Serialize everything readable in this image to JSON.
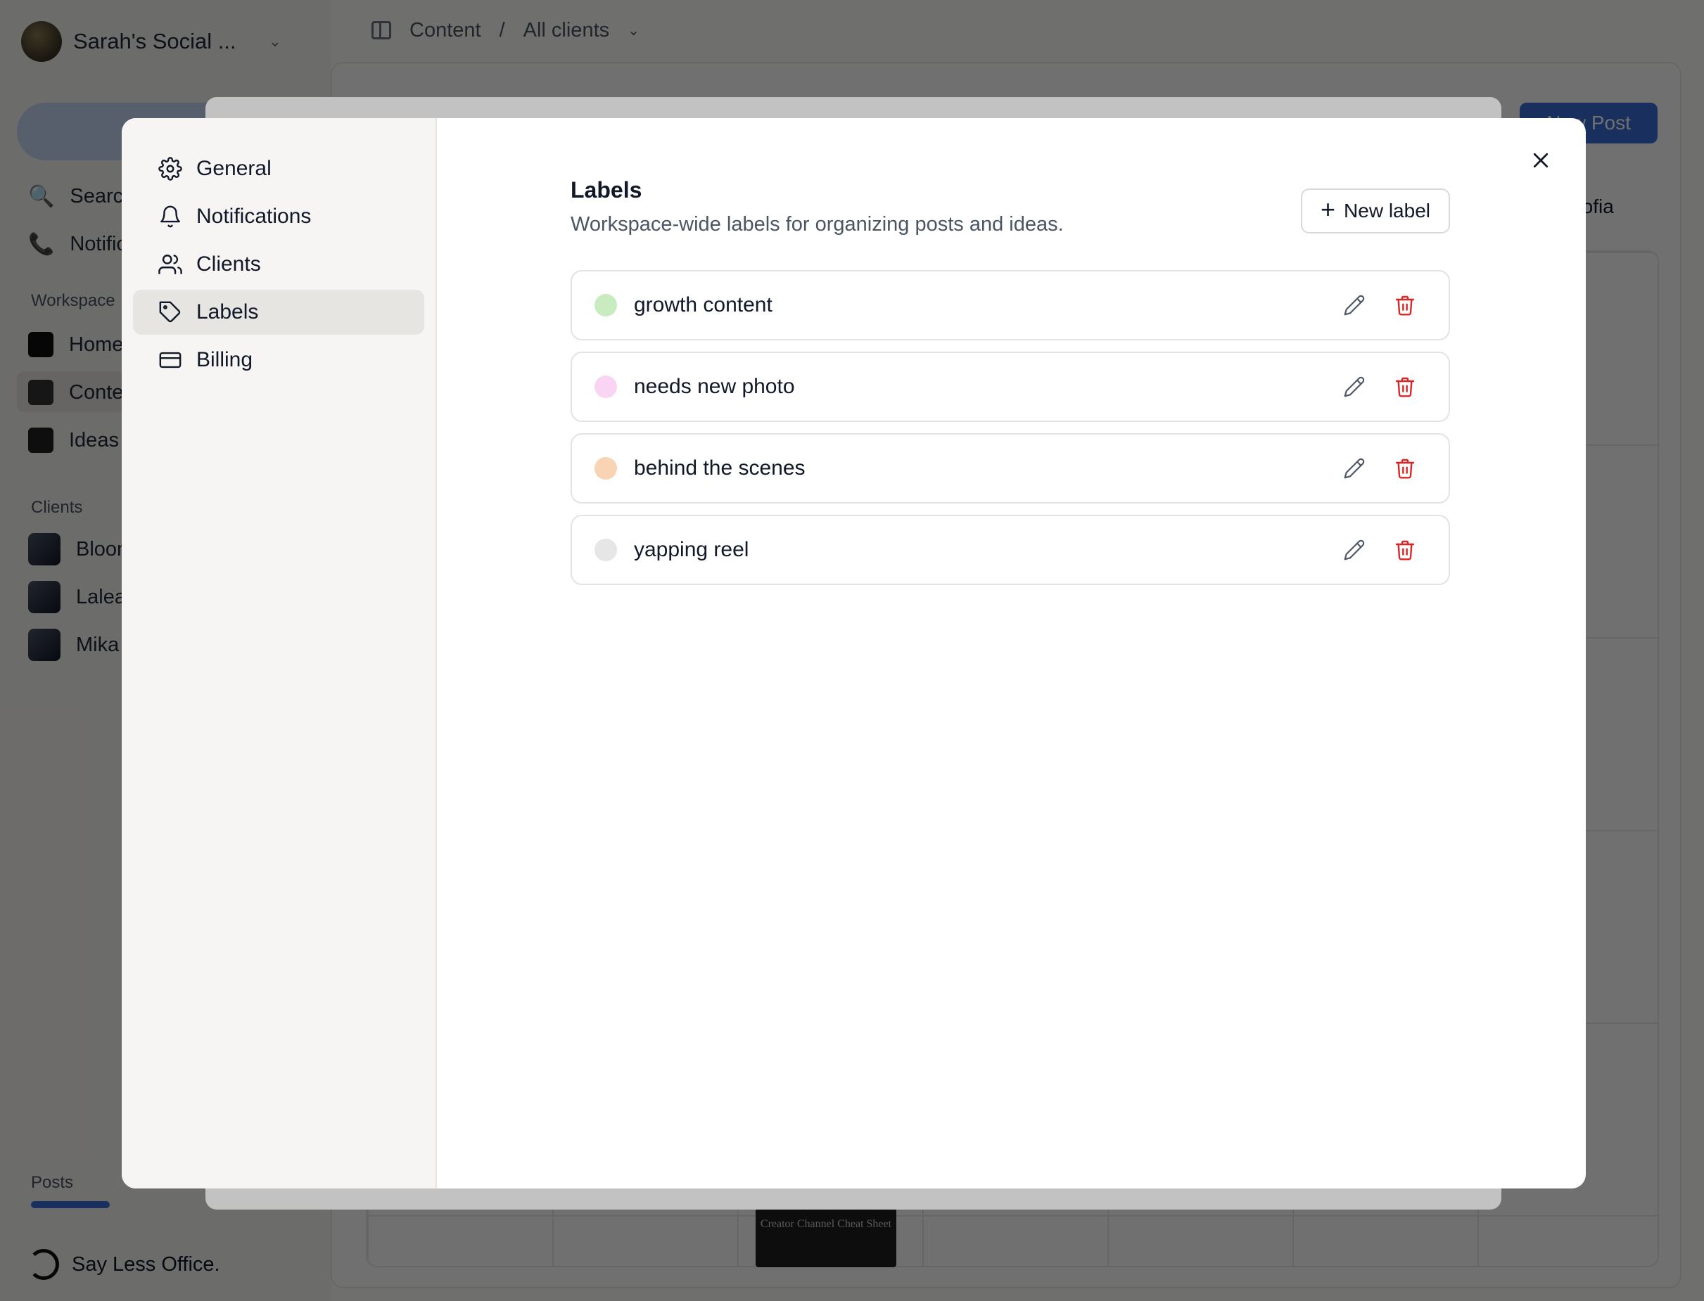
{
  "background": {
    "workspace_name": "Sarah's Social ...",
    "sidebar": {
      "search": "Search",
      "notifications": "Notifications",
      "workspace_section": "Workspace",
      "home": "Home",
      "content": "Content",
      "ideas": "Ideas",
      "clients_section": "Clients",
      "clients": [
        "Bloom",
        "Lalea",
        "Mika"
      ],
      "posts_section": "Posts",
      "brand": "Say Less Office."
    },
    "breadcrumb": {
      "root": "Content",
      "separator": "/",
      "current": "All clients"
    },
    "new_post": "New Post",
    "user_chip": "Sofia",
    "thumb_caption": "Creator Channel Cheat Sheet"
  },
  "settings": {
    "nav": [
      {
        "label": "General",
        "icon": "gear-icon"
      },
      {
        "label": "Notifications",
        "icon": "bell-icon"
      },
      {
        "label": "Clients",
        "icon": "users-icon"
      },
      {
        "label": "Labels",
        "icon": "tag-icon",
        "active": true
      },
      {
        "label": "Billing",
        "icon": "credit-card-icon"
      }
    ],
    "labels_page": {
      "title": "Labels",
      "subtitle": "Workspace-wide labels for organizing posts and ideas.",
      "new_label": "New label",
      "items": [
        {
          "name": "growth content",
          "color": "#c8ecbf"
        },
        {
          "name": "needs new photo",
          "color": "#f9d4f3"
        },
        {
          "name": "behind the scenes",
          "color": "#f8d3b4"
        },
        {
          "name": "yapping reel",
          "color": "#e6e6e6"
        }
      ]
    }
  },
  "colors": {
    "accent": "#3b6fd8",
    "danger": "#dc2626"
  }
}
